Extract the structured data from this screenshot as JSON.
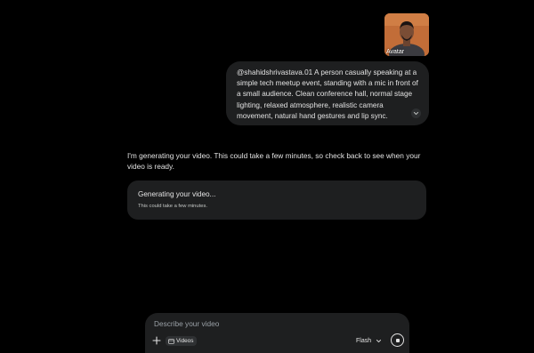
{
  "avatar": {
    "caption": "Avatar"
  },
  "user_message": {
    "text": "@shahidshrivastava.01 A person casually speaking at a simple tech meetup event, standing with a mic in front of a small audience. Clean conference hall, normal stage lighting, relaxed atmosphere, realistic camera movement, natural hand gestures and lip sync.",
    "expand_icon": "chevron-down-icon"
  },
  "assistant_message": {
    "text": "I'm generating your video. This could take a few minutes, so check back to see when your video is ready."
  },
  "generation_card": {
    "title": "Generating your video...",
    "subtitle": "This could take a few minutes."
  },
  "composer": {
    "placeholder": "Describe your video",
    "add_icon": "plus-icon",
    "tool_chip": {
      "icon": "video-icon",
      "label": "Videos"
    },
    "model": {
      "selected": "Flash",
      "icon": "chevron-down-icon"
    },
    "stop_icon": "stop-icon"
  },
  "colors": {
    "background": "#000000",
    "surface": "#1e1f20",
    "text": "#e3e3e3",
    "muted": "#9aa0a6"
  }
}
